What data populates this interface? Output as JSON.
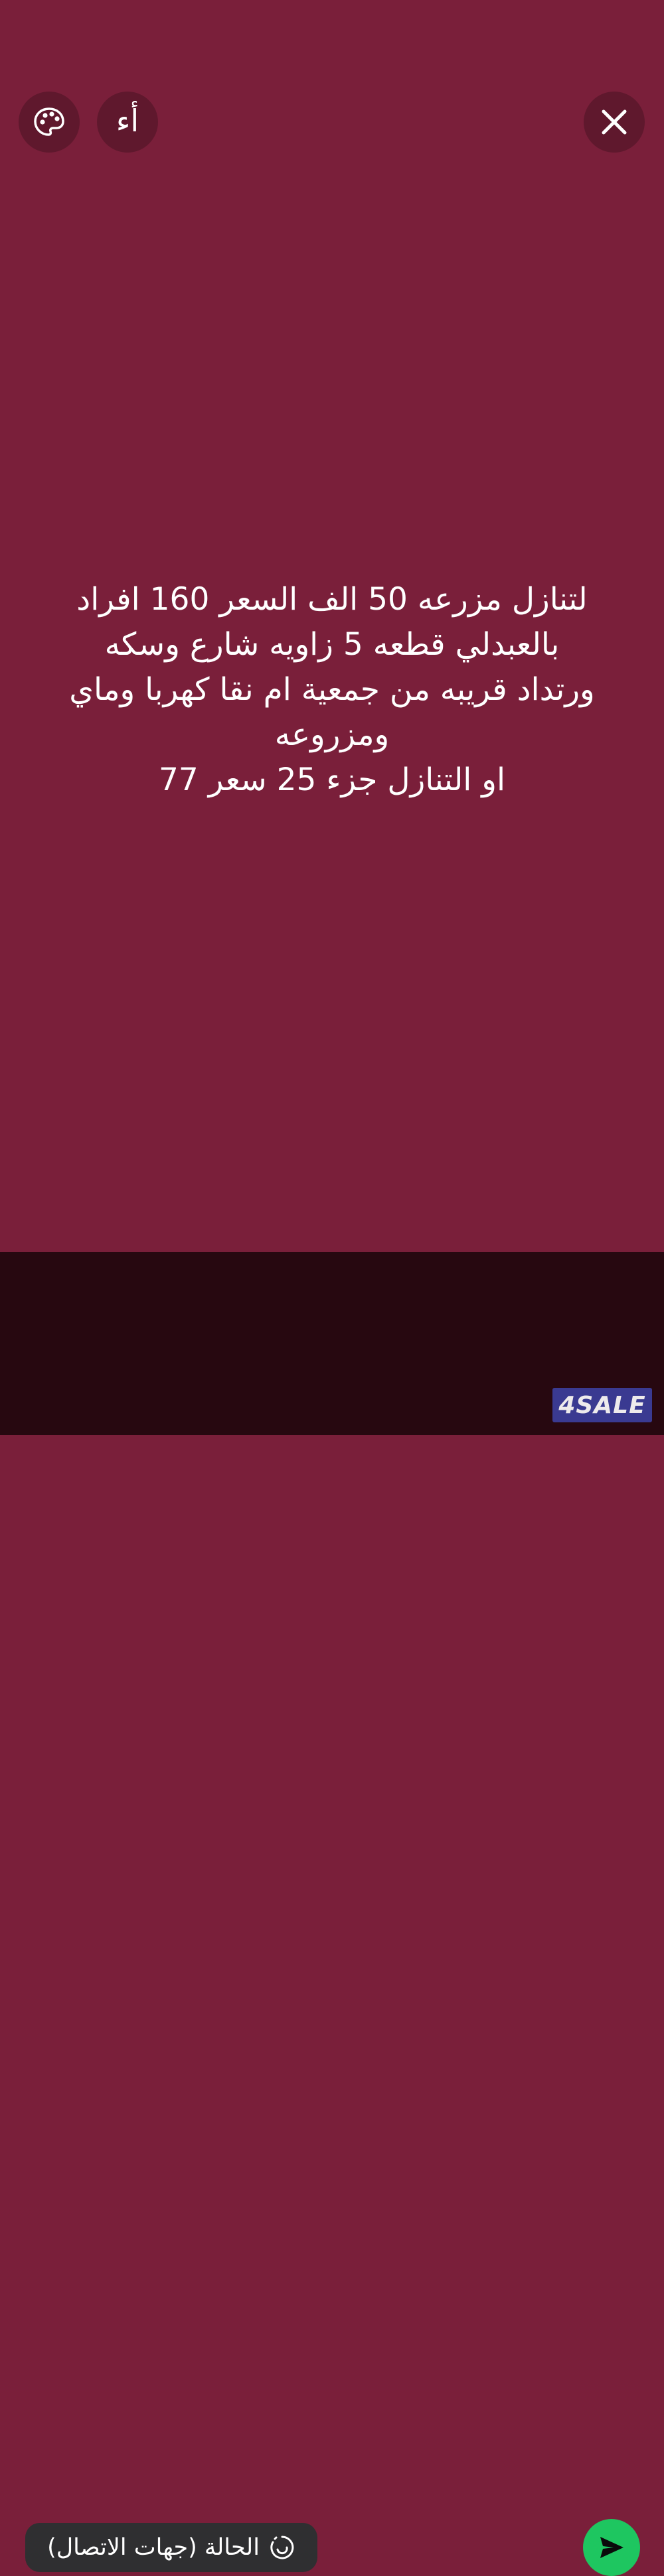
{
  "colors": {
    "background": "#7a1f3a",
    "bottom_bar": "#270810",
    "send_button": "#1ec660",
    "pill": "#2f2f31"
  },
  "toolbar": {
    "palette_icon": "palette-icon",
    "font_label": "أء",
    "close_icon": "close-icon"
  },
  "status": {
    "text": "لتنازل مزرعه 50 الف السعر 160 افراد\nبالعبدلي قطعه 5 زاويه شارع وسكه\nورتداد قريبه من جمعية ام نقا كهربا وماي\nومزروعه\nاو التنازل جزء 25 سعر 77"
  },
  "bottom": {
    "audience_label": "الحالة (جهات الاتصال)",
    "audience_icon": "status-ring-icon",
    "send_icon": "send-icon"
  },
  "watermark": {
    "text": "4SALE"
  }
}
